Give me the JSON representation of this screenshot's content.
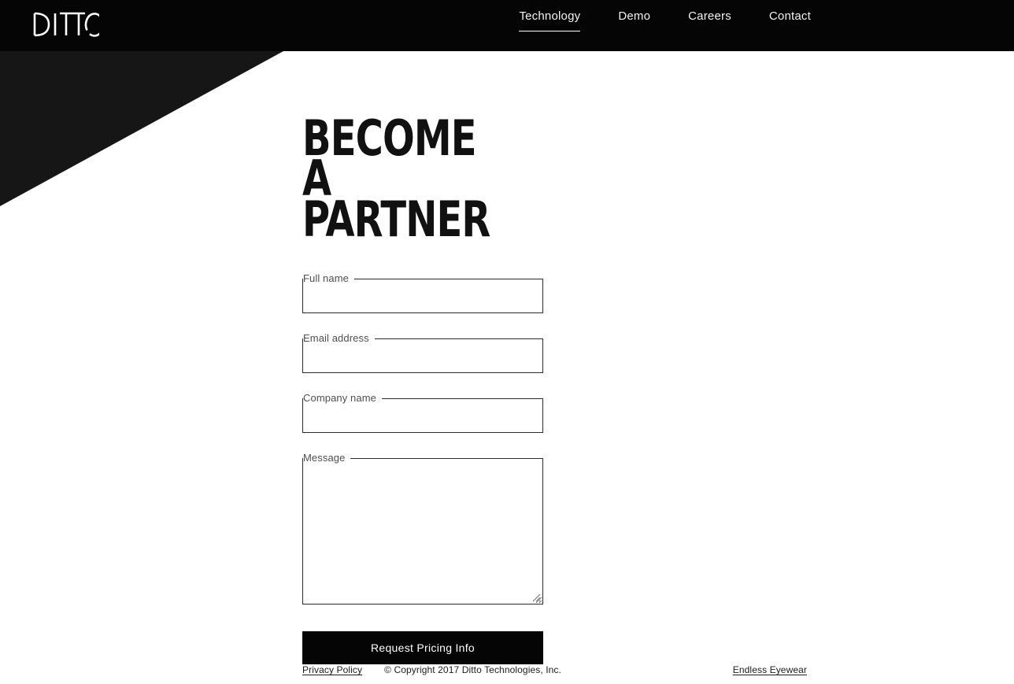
{
  "brand": {
    "logo_text": "DITTO",
    "logo_icon": "ditto-wordmark"
  },
  "colors": {
    "header_black": "#050505",
    "diagonal_dark": "#161616",
    "page_background": "#ffffff",
    "text_dark": "#111111",
    "label_gray": "#4f4f4f",
    "button_black": "#050505",
    "button_text": "#ffffff"
  },
  "nav": {
    "items": [
      {
        "label": "Technology",
        "active": true
      },
      {
        "label": "Demo",
        "active": false
      },
      {
        "label": "Careers",
        "active": false
      },
      {
        "label": "Contact",
        "active": false
      }
    ]
  },
  "main": {
    "title": "BECOME A\nPARTNER"
  },
  "form": {
    "fields": [
      {
        "name": "full-name",
        "label": "Full name",
        "value": "",
        "placeholder": "",
        "type": "text"
      },
      {
        "name": "email",
        "label": "Email address",
        "value": "",
        "placeholder": "",
        "type": "email"
      },
      {
        "name": "company-name",
        "label": "Company name",
        "value": "",
        "placeholder": "",
        "type": "text"
      },
      {
        "name": "message",
        "label": "Message",
        "value": "",
        "placeholder": "",
        "type": "textarea"
      }
    ],
    "submit_label": "Request Pricing Info"
  },
  "footer": {
    "privacy_label": "Privacy Policy",
    "copyright": "© Copyright 2017 Ditto Technologies, Inc.",
    "partner_label": "Endless Eyewear"
  }
}
